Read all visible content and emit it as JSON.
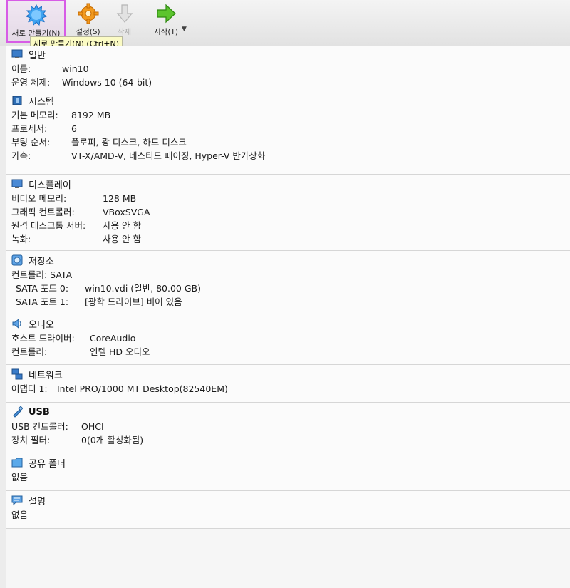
{
  "toolbar": {
    "new_label": "새로 만들기(N)",
    "settings_label": "설정(S)",
    "discard_label": "삭제",
    "start_label": "시작(T)",
    "tooltip": "새로 만들기(N) (Ctrl+N)"
  },
  "sections": {
    "general": {
      "title": "일반",
      "rows": [
        {
          "k": "이름:",
          "v": "win10"
        },
        {
          "k": "운영 체제:",
          "v": "Windows 10 (64-bit)"
        }
      ]
    },
    "system": {
      "title": "시스템",
      "rows": [
        {
          "k": "기본 메모리:",
          "v": "8192 MB"
        },
        {
          "k": "프로세서:",
          "v": "6"
        },
        {
          "k": "부팅 순서:",
          "v": "플로피, 광 디스크, 하드 디스크"
        },
        {
          "k": "가속:",
          "v": "VT-X/AMD-V, 네스티드 페이징, Hyper-V 반가상화"
        }
      ]
    },
    "display": {
      "title": "디스플레이",
      "rows": [
        {
          "k": "비디오 메모리:",
          "v": "128 MB"
        },
        {
          "k": "그래픽 컨트롤러:",
          "v": "VBoxSVGA"
        },
        {
          "k": "원격 데스크톱 서버:",
          "v": "사용 안 함"
        },
        {
          "k": "녹화:",
          "v": "사용 안 함"
        }
      ]
    },
    "storage": {
      "title": "저장소",
      "controller": "컨트롤러: SATA",
      "rows": [
        {
          "k": "SATA 포트 0:",
          "v": "win10.vdi (일반, 80.00 GB)"
        },
        {
          "k": "SATA 포트 1:",
          "v": "[광학 드라이브] 비어 있음"
        }
      ]
    },
    "audio": {
      "title": "오디오",
      "rows": [
        {
          "k": "호스트 드라이버:",
          "v": "CoreAudio"
        },
        {
          "k": "컨트롤러:",
          "v": "인텔 HD 오디오"
        }
      ]
    },
    "network": {
      "title": "네트워크",
      "rows": [
        {
          "k": "어댑터 1:",
          "v": "Intel PRO/1000 MT Desktop(82540EM)"
        }
      ]
    },
    "usb": {
      "title": "USB",
      "rows": [
        {
          "k": "USB 컨트롤러:",
          "v": "OHCI"
        },
        {
          "k": "장치 필터:",
          "v": "0(0개 활성화됨)"
        }
      ]
    },
    "shared": {
      "title": "공유 폴더",
      "value": "없음"
    },
    "description": {
      "title": "설명",
      "value": "없음"
    }
  }
}
